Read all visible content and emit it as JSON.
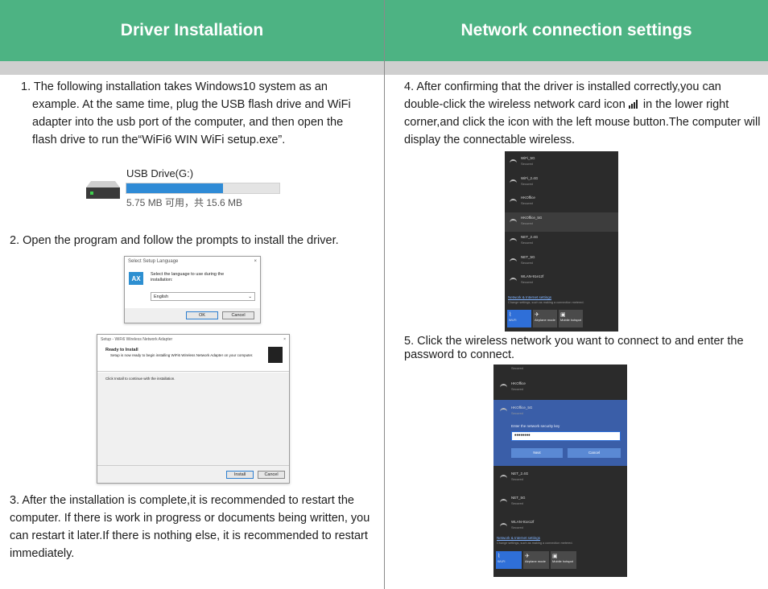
{
  "left": {
    "title": "Driver Installation",
    "step1": "1. The following installation takes Windows10 system as an example. At the same time, plug the USB flash drive and WiFi adapter into the usb port of the computer, and then open the flash drive to run the“WiFi6 WIN WiFi setup.exe”.",
    "usb": {
      "name": "USB Drive(G:)",
      "size": "5.75 MB 可用，共 15.6 MB",
      "used_fraction": 0.63
    },
    "step2": "2. Open the program and follow the prompts to install the driver.",
    "lang_dialog": {
      "title": "Select Setup Language",
      "close": "×",
      "logo": "AX",
      "prompt": "Select the language to use during the installation:",
      "selected": "English",
      "ok": "OK",
      "cancel": "Cancel"
    },
    "setup_dialog": {
      "title": "Setup - WiFi6 Wireless Network Adapter",
      "close": "×",
      "heading": "Ready to Install",
      "desc": "Setup is now ready to begin installing WiFi6 Wireless Network Adapter on your computer.",
      "body": "Click Install to continue with the installation.",
      "install": "Install",
      "cancel": "Cancel"
    },
    "step3": "3. After the installation is complete,it is recommended to restart the computer. If there is work in progress or documents being written, you can restart it later.If there is nothing else, it is recommended to restart immediately."
  },
  "right": {
    "title": "Network connection settings",
    "step4_a": "4. After confirming that the driver is installed correctly,you can double-click the wireless network card icon",
    "step4_b": "in the lower right corner,and click the icon with the left mouse button.The computer will display the connectable wireless.",
    "panel1": {
      "networks": [
        {
          "name": "WiFi_5G",
          "status": "Secured"
        },
        {
          "name": "WiFi_2.4G",
          "status": "Secured"
        },
        {
          "name": "HKOffice",
          "status": "Secured"
        },
        {
          "name": "HKOffice_5G",
          "status": "Secured"
        },
        {
          "name": "NET_2.4G",
          "status": "Secured"
        },
        {
          "name": "NET_5G",
          "status": "Secured"
        },
        {
          "name": "WLAN-91e12f",
          "status": "Secured"
        }
      ],
      "settings_link": "Network & Internet settings",
      "settings_hint": "Change settings, such as making a connection metered.",
      "tiles": [
        {
          "icon": "wifi-icon",
          "label": "Wi-Fi"
        },
        {
          "icon": "airplane-icon",
          "label": "Airplane mode"
        },
        {
          "icon": "mobile-hotspot-icon",
          "label": "Mobile hotspot"
        }
      ]
    },
    "step5": "5. Click the wireless network you want to connect to and enter the password to connect.",
    "panel2": {
      "top_status": "Secured",
      "networks_before": [
        {
          "name": "HKOffice",
          "status": "Secured"
        }
      ],
      "selected": {
        "name": "HKOffice_5G",
        "status": "Secured",
        "prompt": "Enter the network security key",
        "password_mask": "••••••••",
        "next": "Next",
        "cancel": "Cancel"
      },
      "networks_after": [
        {
          "name": "NET_2.4G",
          "status": "Secured"
        },
        {
          "name": "NET_5G",
          "status": "Secured"
        },
        {
          "name": "WLAN-91e12f",
          "status": "Secured"
        }
      ],
      "settings_link": "Network & Internet settings",
      "settings_hint": "Change settings, such as making a connection metered.",
      "tiles": [
        {
          "icon": "wifi-icon",
          "label": "Wi-Fi"
        },
        {
          "icon": "airplane-icon",
          "label": "Airplane mode"
        },
        {
          "icon": "mobile-hotspot-icon",
          "label": "Mobile hotspot"
        }
      ]
    }
  }
}
